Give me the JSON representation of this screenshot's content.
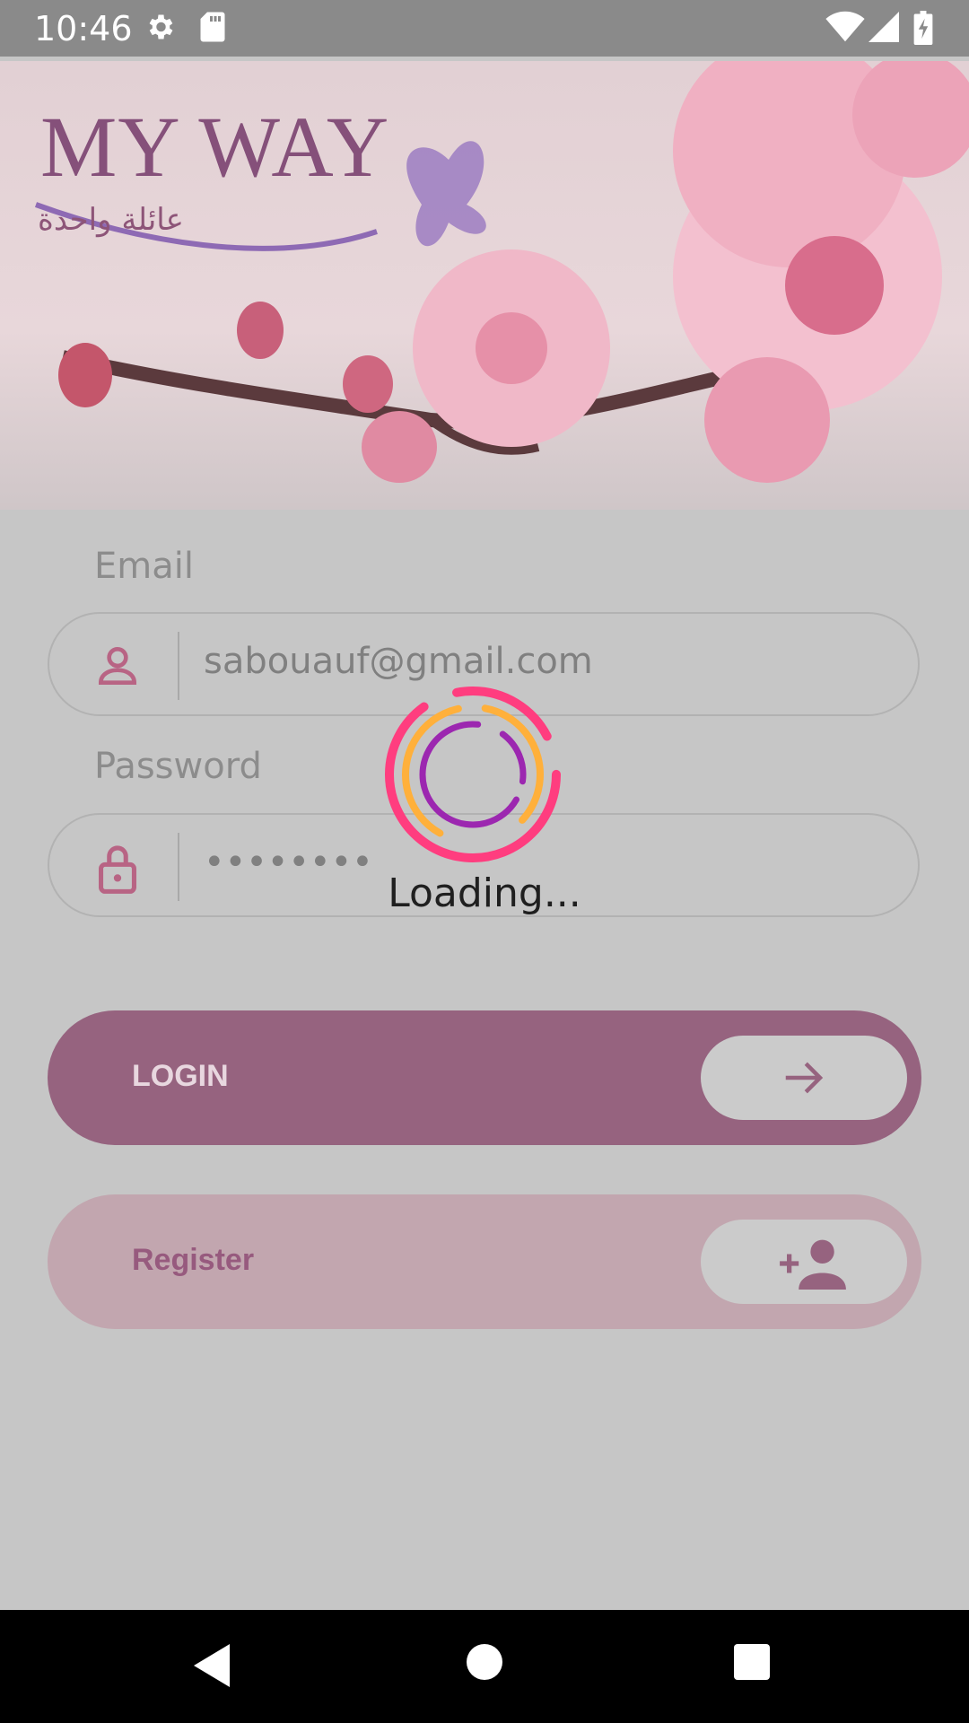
{
  "status_bar": {
    "time": "10:46"
  },
  "header": {
    "brand_title": "MY WAY",
    "brand_subtitle": "عائلة واحدة"
  },
  "form": {
    "email_label": "Email",
    "email_value": "sabouauf@gmail.com",
    "password_label": "Password",
    "password_value": "••••••••"
  },
  "buttons": {
    "login_label": "LOGIN",
    "register_label": "Register"
  },
  "overlay": {
    "loading_text": "Loading..."
  },
  "colors": {
    "accent": "#96637f",
    "register_bg": "#c2a6af",
    "spinner_outer": "#ff3d7f",
    "spinner_middle": "#ffb03b",
    "spinner_inner": "#9c27b0"
  },
  "icons": {
    "status": [
      "settings-icon",
      "sd-card-icon",
      "wifi-icon",
      "signal-icon",
      "battery-icon"
    ],
    "email_field": "person-icon",
    "password_field": "lock-icon",
    "login": "arrow-right-icon",
    "register": "add-person-icon",
    "nav": [
      "back-icon",
      "home-icon",
      "recents-icon"
    ]
  }
}
